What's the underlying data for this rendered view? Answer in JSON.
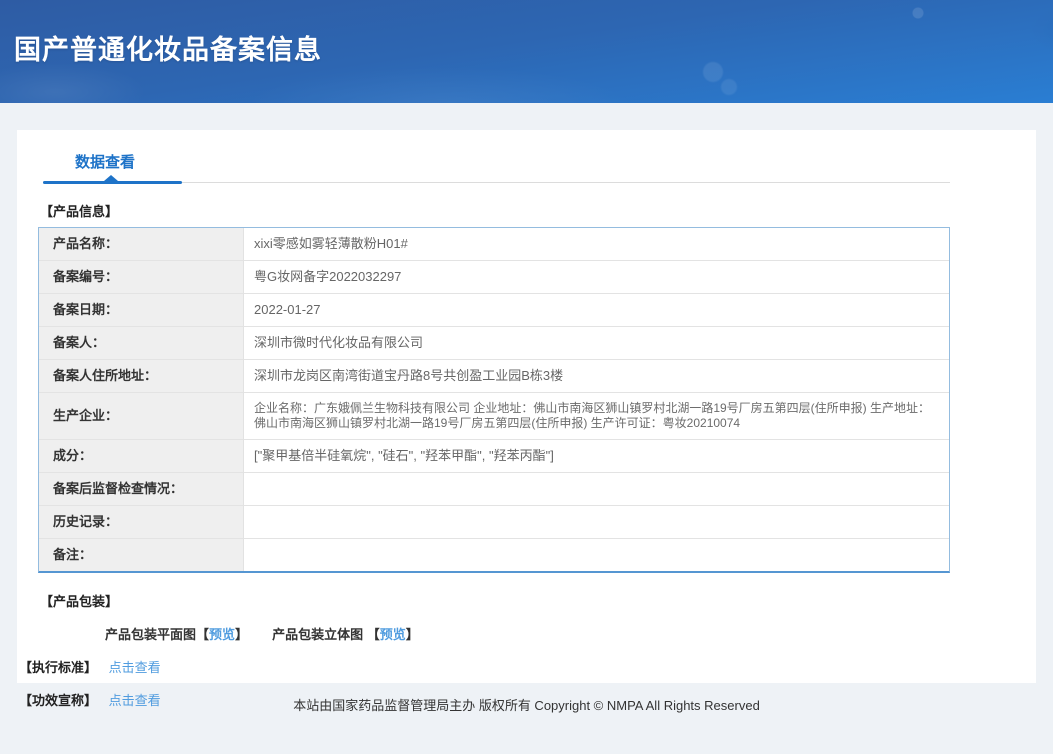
{
  "page": {
    "title": "国产普通化妆品备案信息",
    "footer": "本站由国家药品监督管理局主办 版权所有 Copyright © NMPA All Rights Reserved",
    "colors": {
      "banner_top": "#2e5ca4",
      "banner_bottom": "#2a7ed3",
      "tab_accent": "#1e73c8",
      "link_blue": "#509cdf",
      "table_border": "#94bcdf",
      "label_cell_bg": "#efefef"
    }
  },
  "tab": {
    "label": "数据查看"
  },
  "product_info": {
    "section_title": "【产品信息】",
    "rows": [
      {
        "label": "产品名称：",
        "value": "xixi零感如雾轻薄散粉H01#"
      },
      {
        "label": "备案编号：",
        "value": "粤G妆网备字2022032297"
      },
      {
        "label": "备案日期：",
        "value": "2022-01-27"
      },
      {
        "label": "备案人：",
        "value": "深圳市微时代化妆品有限公司"
      },
      {
        "label": "备案人住所地址：",
        "value": "深圳市龙岗区南湾街道宝丹路8号共创盈工业园B栋3楼"
      },
      {
        "label": "生产企业：",
        "value": "企业名称：广东娥佩兰生物科技有限公司 企业地址：佛山市南海区狮山镇罗村北湖一路19号厂房五第四层(住所申报) 生产地址：佛山市南海区狮山镇罗村北湖一路19号厂房五第四层(住所申报) 生产许可证：粤妆20210074"
      },
      {
        "label": "成分：",
        "value": "[\"聚甲基倍半硅氧烷\", \"硅石\", \"羟苯甲酯\", \"羟苯丙酯\"]"
      },
      {
        "label": "备案后监督检查情况：",
        "value": ""
      },
      {
        "label": "历史记录：",
        "value": ""
      },
      {
        "label": "备注：",
        "value": ""
      }
    ]
  },
  "packaging": {
    "section_title": "【产品包装】",
    "items": [
      {
        "label": "产品包装平面图",
        "open": "【",
        "link": "预览",
        "close": "】"
      },
      {
        "label": "产品包装立体图",
        "open": "【",
        "link": "预览",
        "close": "】"
      }
    ]
  },
  "standard": {
    "title": "【执行标准】",
    "link": "点击查看"
  },
  "efficacy": {
    "title": "【功效宣称】",
    "link": "点击查看"
  }
}
